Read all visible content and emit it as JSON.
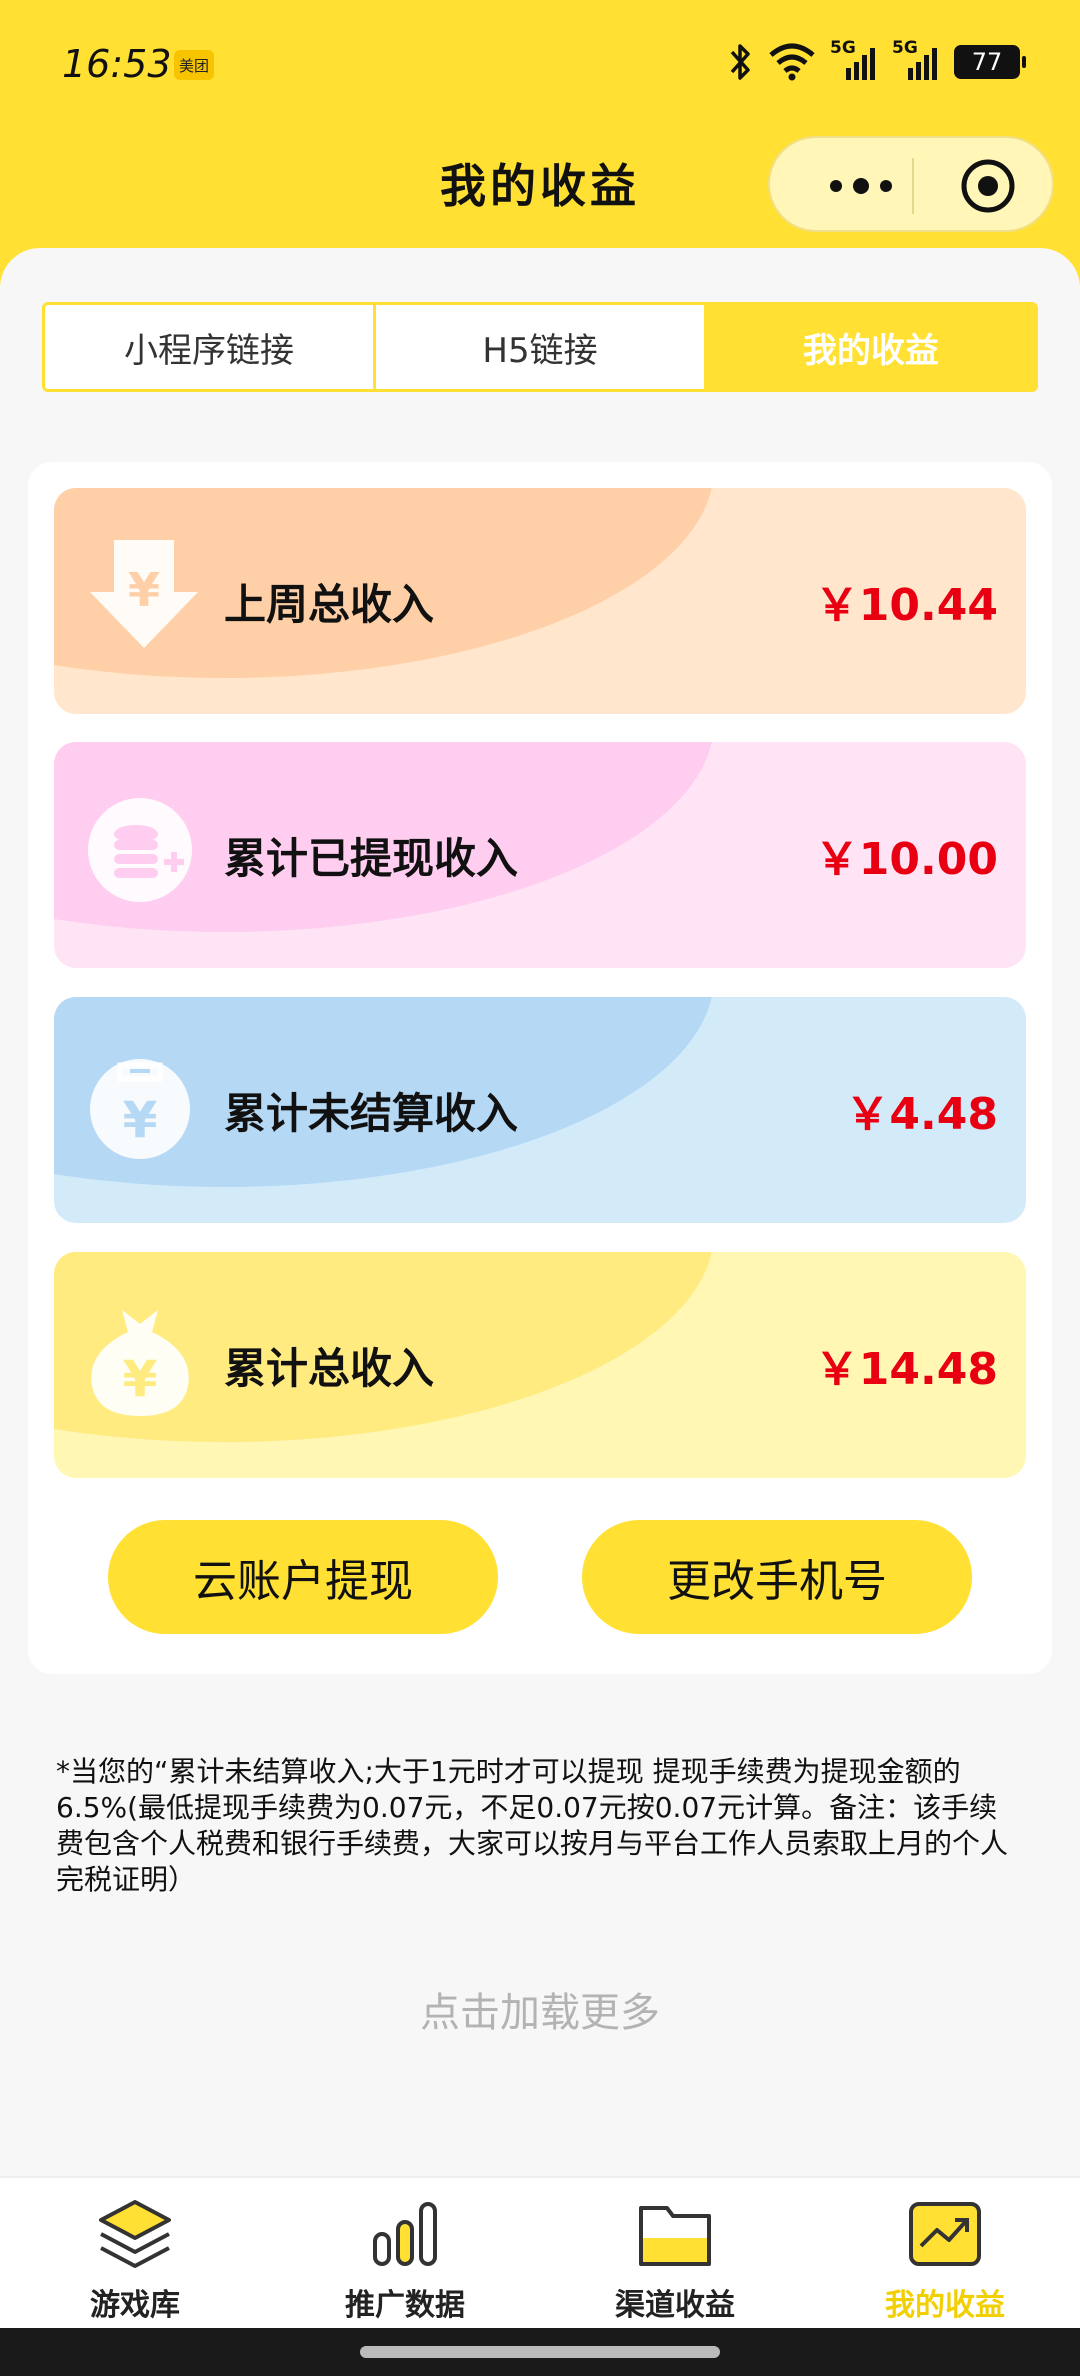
{
  "status_bar": {
    "time": "16:53",
    "app_badge": "美团",
    "battery": "77",
    "network_1": "5G",
    "network_2": "5G"
  },
  "nav": {
    "title": "我的收益"
  },
  "tabs": [
    {
      "label": "小程序链接",
      "active": false
    },
    {
      "label": "H5链接",
      "active": false
    },
    {
      "label": "我的收益",
      "active": true
    }
  ],
  "income_cards": [
    {
      "label": "上周总收入",
      "amount": "￥10.44",
      "icon": "yuan-down-arrow-icon"
    },
    {
      "label": "累计已提现收入",
      "amount": "￥10.00",
      "icon": "coins-plus-icon"
    },
    {
      "label": "累计未结算收入",
      "amount": "￥4.48",
      "icon": "yuan-bag-icon"
    },
    {
      "label": "累计总收入",
      "amount": "￥14.48",
      "icon": "money-bag-icon"
    }
  ],
  "actions": {
    "withdraw": "云账户提现",
    "change_phone": "更改手机号"
  },
  "note": "*当您的“累计未结算收入;大于1元时才可以提现 提现手续费为提现金额的6.5%(最低提现手续费为0.07元，不足0.07元按0.07元计算。备注：该手续费包含个人税费和银行手续费，大家可以按月与平台工作人员索取上月的个人完税证明）",
  "load_more": "点击加载更多",
  "tabbar": [
    {
      "label": "游戏库",
      "icon": "layers-icon",
      "active": false
    },
    {
      "label": "推广数据",
      "icon": "bar-chart-icon",
      "active": false
    },
    {
      "label": "渠道收益",
      "icon": "folder-icon",
      "active": false
    },
    {
      "label": "我的收益",
      "icon": "trend-up-icon",
      "active": true
    }
  ],
  "colors": {
    "brand_yellow": "#ffe033",
    "amount_red": "#e80012",
    "active_tab_text": "#f2cf00"
  }
}
